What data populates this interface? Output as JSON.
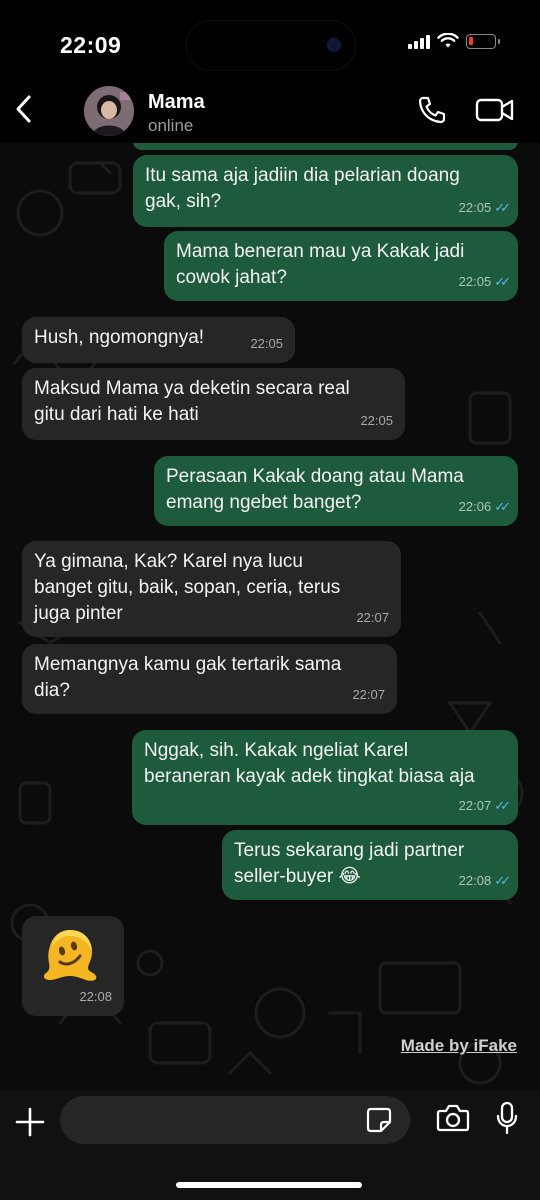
{
  "status_bar": {
    "time": "22:09"
  },
  "header": {
    "contact_name": "Mama",
    "presence": "online"
  },
  "messages": [
    {
      "direction": "out",
      "text": "Itu sama aja jadiin dia pelarian doang\ngak, sih?",
      "time": "22:05",
      "read": true
    },
    {
      "direction": "out",
      "text": "Mama beneran mau ya Kakak jadi\ncowok jahat?",
      "time": "22:05",
      "read": true
    },
    {
      "direction": "in",
      "text": "Hush, ngomongnya!",
      "time": "22:05"
    },
    {
      "direction": "in",
      "text": "Maksud Mama ya deketin secara real\ngitu dari hati ke hati",
      "time": "22:05"
    },
    {
      "direction": "out",
      "text": "Perasaan Kakak doang atau Mama\nemang ngebet banget?",
      "time": "22:06",
      "read": true
    },
    {
      "direction": "in",
      "text": "Ya gimana, Kak? Karel nya lucu\nbanget gitu, baik, sopan, ceria, terus\njuga pinter",
      "time": "22:07"
    },
    {
      "direction": "in",
      "text": "Memangnya kamu gak tertarik sama\ndia?",
      "time": "22:07"
    },
    {
      "direction": "out",
      "text": "Nggak, sih. Kakak ngeliat Karel\nberaneran kayak adek tingkat biasa aja",
      "time": "22:07",
      "read": true
    },
    {
      "direction": "out",
      "text": "Terus sekarang jadi partner\nseller-buyer 😂",
      "time": "22:08",
      "read": true
    },
    {
      "direction": "in",
      "emoji": "melting-face",
      "time": "22:08"
    }
  ],
  "watermark": "Made by iFake",
  "composer": {
    "placeholder": ""
  },
  "colors": {
    "outgoing": "#1e5a3c",
    "incoming": "#262626",
    "read_ticks": "#53bdeb"
  }
}
